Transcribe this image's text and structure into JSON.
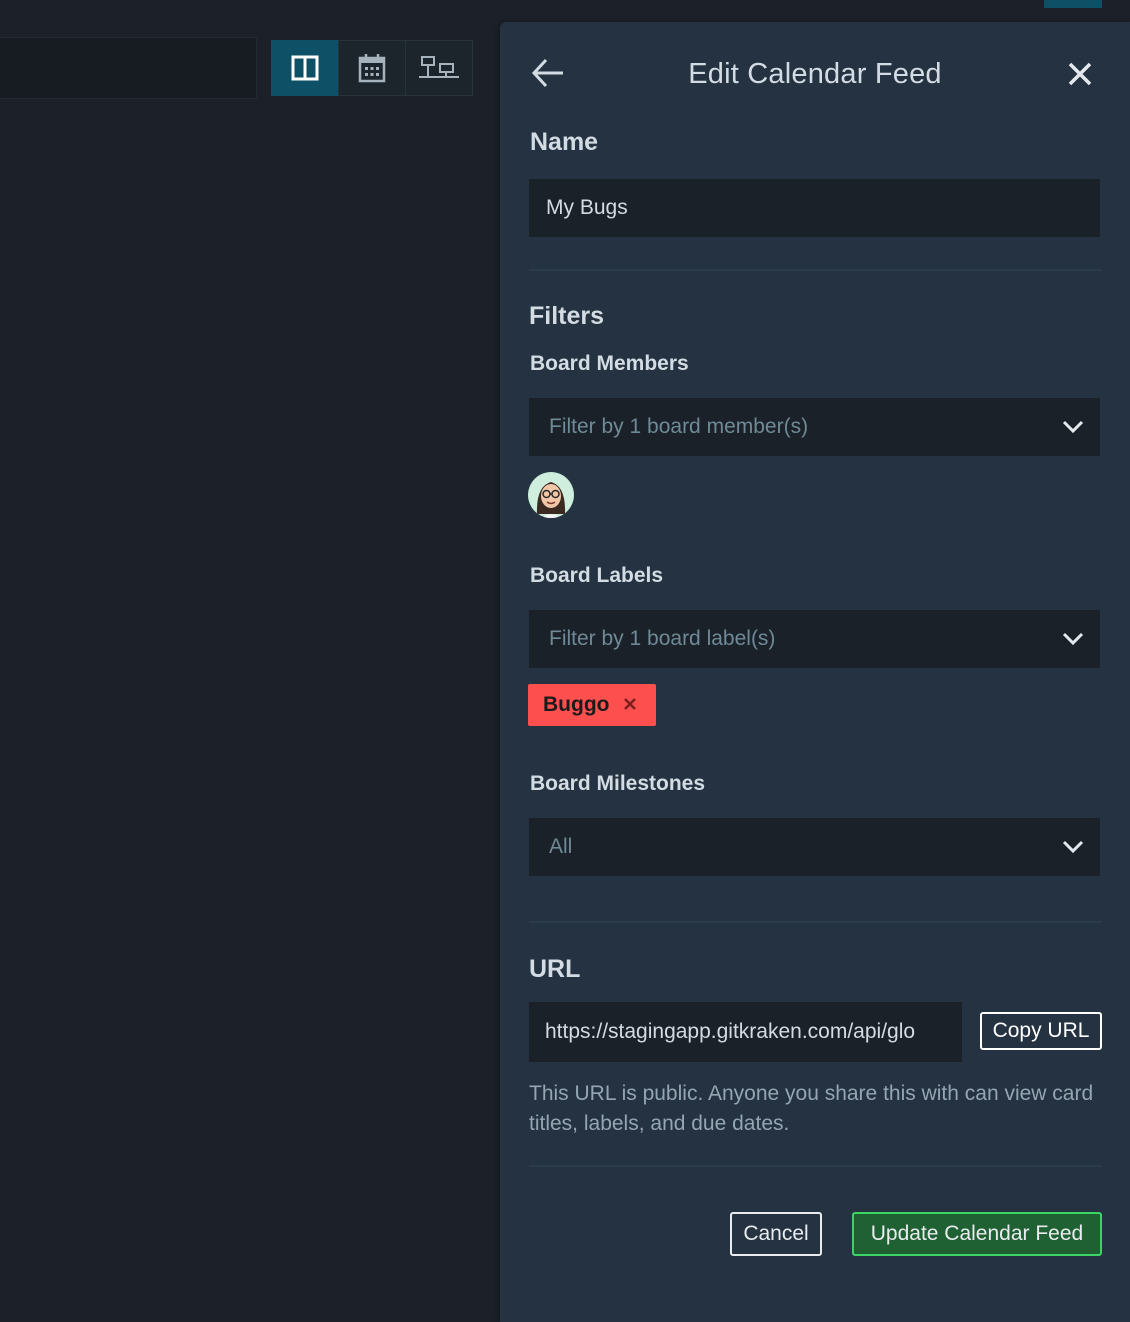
{
  "panel": {
    "title": "Edit Calendar Feed",
    "back_icon": "arrow-left-icon",
    "close_icon": "close-icon"
  },
  "name": {
    "label": "Name",
    "value": "My Bugs"
  },
  "filters": {
    "title": "Filters",
    "members": {
      "label": "Board Members",
      "placeholder": "Filter by 1 board member(s)"
    },
    "labels": {
      "label": "Board Labels",
      "placeholder": "Filter by 1 board label(s)",
      "chips": [
        {
          "text": "Buggo",
          "color": "#fe4f4f"
        }
      ]
    },
    "milestones": {
      "label": "Board Milestones",
      "value": "All"
    }
  },
  "url": {
    "title": "URL",
    "value": "https://stagingapp.gitkraken.com/api/glo",
    "copy_label": "Copy URL",
    "help": "This URL is public. Anyone you share this with can view card titles, labels, and due dates."
  },
  "actions": {
    "cancel_label": "Cancel",
    "update_label": "Update Calendar Feed"
  },
  "colors": {
    "accent": "#0e5066",
    "success": "#3dd465",
    "panel": "#243241",
    "label_red": "#fe4f4f"
  }
}
